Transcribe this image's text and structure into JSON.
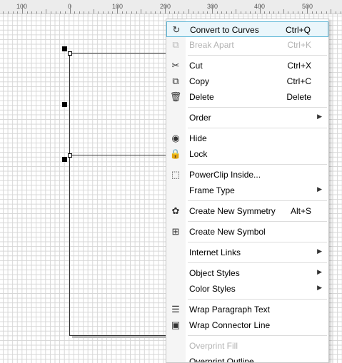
{
  "ruler": {
    "labels": [
      "100",
      "0",
      "100",
      "200",
      "300",
      "400",
      "500"
    ]
  },
  "menu": {
    "items": [
      {
        "name": "menu-item-convert-to-curves",
        "icon": "convert-to-curves-icon",
        "glyph": "↻",
        "label": "Convert to Curves",
        "shortcut": "Ctrl+Q",
        "submenu": false,
        "disabled": false,
        "selected": true
      },
      {
        "name": "menu-item-break-apart",
        "icon": "break-apart-icon",
        "glyph": "⧉",
        "label": "Break Apart",
        "shortcut": "Ctrl+K",
        "submenu": false,
        "disabled": true,
        "selected": false
      },
      {
        "name": "menu-item-cut",
        "icon": "cut-icon",
        "glyph": "✂",
        "label": "Cut",
        "shortcut": "Ctrl+X",
        "submenu": false,
        "disabled": false,
        "selected": false
      },
      {
        "name": "menu-item-copy",
        "icon": "copy-icon",
        "glyph": "⧉",
        "label": "Copy",
        "shortcut": "Ctrl+C",
        "submenu": false,
        "disabled": false,
        "selected": false
      },
      {
        "name": "menu-item-delete",
        "icon": "trash-icon",
        "glyph": "🗑",
        "label": "Delete",
        "shortcut": "Delete",
        "submenu": false,
        "disabled": false,
        "selected": false
      },
      {
        "name": "menu-item-order",
        "icon": "",
        "glyph": "",
        "label": "Order",
        "shortcut": "",
        "submenu": true,
        "disabled": false,
        "selected": false
      },
      {
        "name": "menu-item-hide",
        "icon": "hide-eye-icon",
        "glyph": "◉",
        "label": "Hide",
        "shortcut": "",
        "submenu": false,
        "disabled": false,
        "selected": false
      },
      {
        "name": "menu-item-lock",
        "icon": "lock-icon",
        "glyph": "🔒",
        "label": "Lock",
        "shortcut": "",
        "submenu": false,
        "disabled": false,
        "selected": false
      },
      {
        "name": "menu-item-powerclip-inside",
        "icon": "powerclip-icon",
        "glyph": "⬚",
        "label": "PowerClip Inside...",
        "shortcut": "",
        "submenu": false,
        "disabled": false,
        "selected": false
      },
      {
        "name": "menu-item-frame-type",
        "icon": "",
        "glyph": "",
        "label": "Frame Type",
        "shortcut": "",
        "submenu": true,
        "disabled": false,
        "selected": false
      },
      {
        "name": "menu-item-create-new-symmetry",
        "icon": "symmetry-icon",
        "glyph": "✿",
        "label": "Create New Symmetry",
        "shortcut": "Alt+S",
        "submenu": false,
        "disabled": false,
        "selected": false
      },
      {
        "name": "menu-item-create-new-symbol",
        "icon": "new-symbol-icon",
        "glyph": "⊞",
        "label": "Create New Symbol",
        "shortcut": "",
        "submenu": false,
        "disabled": false,
        "selected": false
      },
      {
        "name": "menu-item-internet-links",
        "icon": "",
        "glyph": "",
        "label": "Internet Links",
        "shortcut": "",
        "submenu": true,
        "disabled": false,
        "selected": false
      },
      {
        "name": "menu-item-object-styles",
        "icon": "",
        "glyph": "",
        "label": "Object Styles",
        "shortcut": "",
        "submenu": true,
        "disabled": false,
        "selected": false
      },
      {
        "name": "menu-item-color-styles",
        "icon": "",
        "glyph": "",
        "label": "Color Styles",
        "shortcut": "",
        "submenu": true,
        "disabled": false,
        "selected": false
      },
      {
        "name": "menu-item-wrap-paragraph-text",
        "icon": "wrap-text-icon",
        "glyph": "☰",
        "label": "Wrap Paragraph Text",
        "shortcut": "",
        "submenu": false,
        "disabled": false,
        "selected": false
      },
      {
        "name": "menu-item-wrap-connector-line",
        "icon": "wrap-connector-icon",
        "glyph": "▣",
        "label": "Wrap Connector Line",
        "shortcut": "",
        "submenu": false,
        "disabled": false,
        "selected": false
      },
      {
        "name": "menu-item-overprint-fill",
        "icon": "",
        "glyph": "",
        "label": "Overprint Fill",
        "shortcut": "",
        "submenu": false,
        "disabled": true,
        "selected": false
      },
      {
        "name": "menu-item-overprint-outline",
        "icon": "",
        "glyph": "",
        "label": "Overprint Outline",
        "shortcut": "",
        "submenu": false,
        "disabled": false,
        "selected": false
      }
    ]
  },
  "colors": {
    "selected_bg": "#eaf6fb",
    "selected_border": "#5bb5d5",
    "disabled_text": "#b3b3b3"
  }
}
